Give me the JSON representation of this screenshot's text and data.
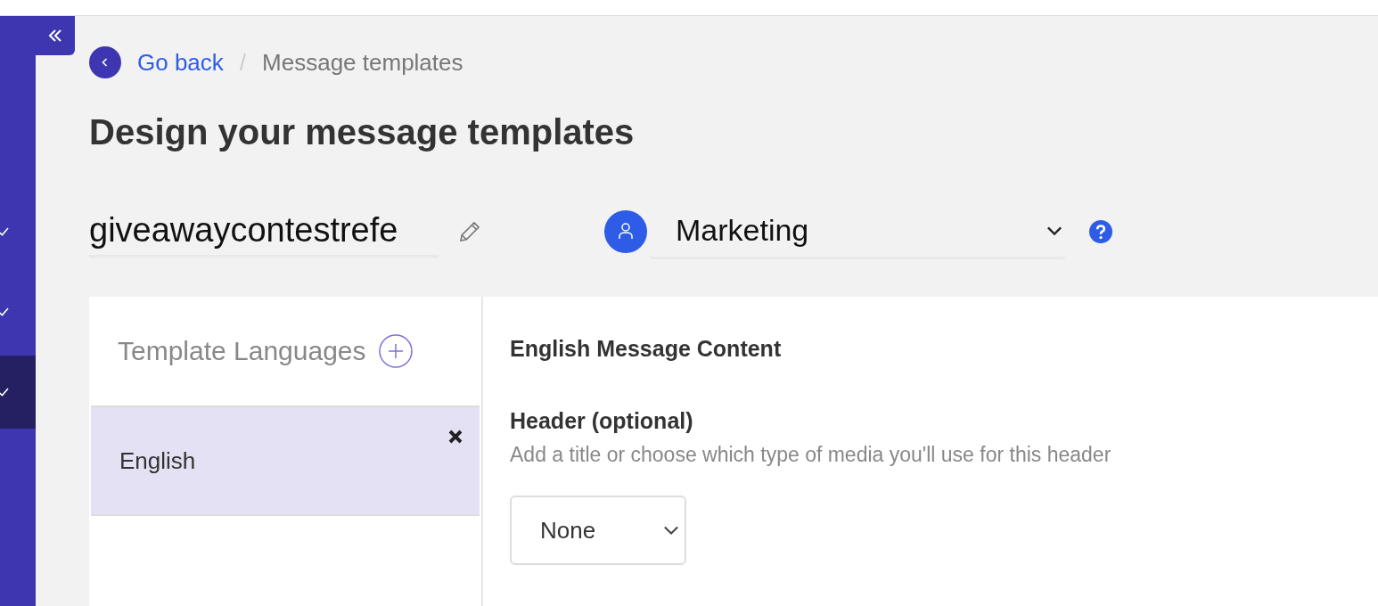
{
  "sidebar": {
    "steps": [
      {
        "checked": true,
        "selected": false
      },
      {
        "checked": true,
        "selected": false
      },
      {
        "checked": true,
        "selected": true
      }
    ]
  },
  "breadcrumb": {
    "back": "Go back",
    "separator": "/",
    "current": "Message templates"
  },
  "title": "Design your message templates",
  "template_name": {
    "value": "giveawaycontestrefe"
  },
  "category": {
    "value": "Marketing"
  },
  "languages": {
    "title": "Template Languages",
    "items": [
      {
        "label": "English",
        "selected": true
      }
    ]
  },
  "content": {
    "title": "English Message Content",
    "header_label": "Header (optional)",
    "header_hint": "Add a title or choose which type of media you'll use for this header",
    "header_type": "None"
  }
}
